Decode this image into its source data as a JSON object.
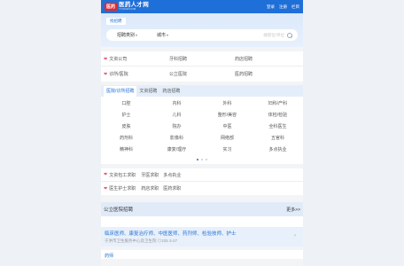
{
  "header": {
    "logo_badge": "医药",
    "logo_main": "医药人才网",
    "logo_sub": "YY.RCW.COM",
    "links": [
      "登录",
      "注册",
      "栏目"
    ]
  },
  "search": {
    "tab_label": "找招聘",
    "category": "招聘类别",
    "city": "城市",
    "placeholder": "搜职位/单位"
  },
  "quick_links": [
    [
      "文资公司",
      "牙科招聘",
      "药店招聘"
    ],
    [
      "诊所/医院",
      "公立医院",
      "医药招聘"
    ]
  ],
  "category_tabs": [
    "医院/诊所招聘",
    "文资招聘",
    "药店招聘"
  ],
  "category_grid": [
    [
      "口腔",
      "内科",
      "外科",
      "妇科/产科"
    ],
    [
      "护士",
      "儿科",
      "整形/美容",
      "体检/检验"
    ],
    [
      "皮肤",
      "院办",
      "中医",
      "全科医生"
    ],
    [
      "药剂科",
      "影像科",
      "网络部",
      "五官科"
    ],
    [
      "精神科",
      "康复/理疗",
      "实习",
      "多点执业"
    ]
  ],
  "quick_links2": [
    {
      "label": "文资包工求职",
      "links": [
        "牙医求职",
        "多点执业"
      ]
    },
    {
      "label": "医生护士求职",
      "links": [
        "药店求职",
        "医药求职"
      ]
    }
  ],
  "section": {
    "title": "公立医院招聘",
    "more": "更多>>"
  },
  "jobs": [
    {
      "title": "临床医师、康复治疗师、中医医师、药剂师、检验技师、护士",
      "meta": "于洪市卫生服务中心及卫生院 ◎225 3-27"
    },
    {
      "title": "药师"
    }
  ]
}
